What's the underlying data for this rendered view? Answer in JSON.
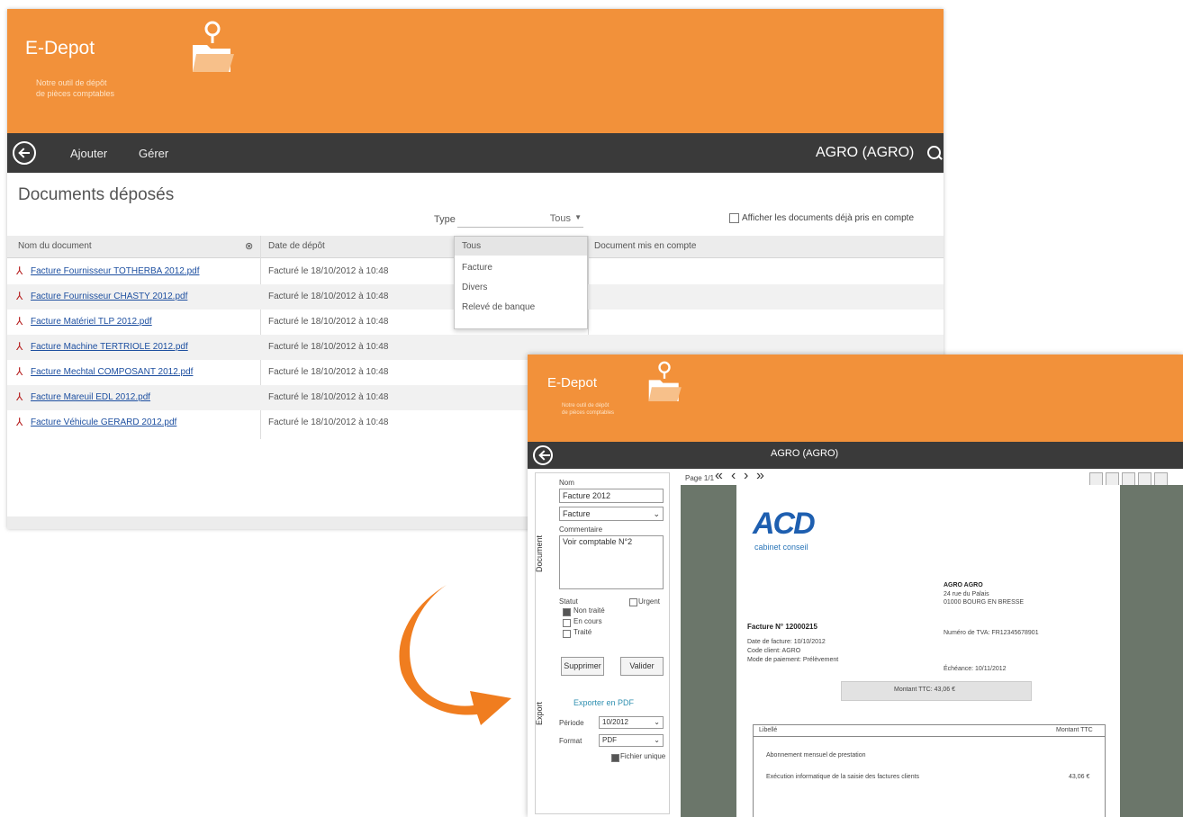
{
  "colors": {
    "accent": "#f2913a",
    "navbar": "#3a3a3a",
    "arrow": "#f07d1f",
    "viewer_bg": "#6b766a",
    "link": "#1d4fa0"
  },
  "main_window": {
    "app_title": "E-Depot",
    "app_subtitle": [
      "Notre outil de dépôt",
      "de pièces comptables"
    ],
    "nav": {
      "add": "Ajouter",
      "manage": "Gérer",
      "org": "AGRO (AGRO)"
    },
    "page_title": "Documents déposés",
    "type_filter": {
      "label": "Type",
      "value": "Tous"
    },
    "show_accounted_label": "Afficher les documents déjà pris en compte",
    "columns": [
      "Nom du document",
      "Date de dépôt",
      "Document mis en compte"
    ],
    "type_options": [
      "Tous",
      "Facture",
      "Divers",
      "Relevé de banque"
    ],
    "documents": [
      {
        "name": "Facture Fournisseur TOTHERBA 2012.pdf",
        "date": "Facturé le 18/10/2012 à 10:48"
      },
      {
        "name": "Facture Fournisseur CHASTY 2012.pdf",
        "date": "Facturé le 18/10/2012 à 10:48"
      },
      {
        "name": "Facture Matériel TLP 2012.pdf",
        "date": "Facturé le 18/10/2012 à 10:48"
      },
      {
        "name": "Facture Machine TERTRIOLE 2012.pdf",
        "date": "Facturé le 18/10/2012 à 10:48"
      },
      {
        "name": "Facture Mechtal COMPOSANT 2012.pdf",
        "date": "Facturé le 18/10/2012 à 10:48"
      },
      {
        "name": "Facture Mareuil EDL 2012.pdf",
        "date": "Facturé le 18/10/2012 à 10:48"
      },
      {
        "name": "Facture Véhicule GERARD 2012.pdf",
        "date": "Facturé le 18/10/2012 à 10:48"
      }
    ]
  },
  "detail_window": {
    "app_title": "E-Depot",
    "app_subtitle": [
      "Notre outil de dépôt",
      "de pièces comptables"
    ],
    "org": "AGRO (AGRO)",
    "side_tab_doc": "Document",
    "side_tab_export": "Export",
    "form": {
      "name_label": "Nom",
      "name_value": "Facture 2012",
      "type_value": "Facture",
      "comment_label": "Commentaire",
      "comment_value": "Voir comptable N°2",
      "status_label": "Statut",
      "status_options": [
        "Non traité",
        "En cours",
        "Traité"
      ],
      "urgent_label": "Urgent",
      "delete_button": "Supprimer",
      "save_button": "Valider",
      "export_title": "Exporter en PDF",
      "period_label": "Période",
      "period_value": "10/2012",
      "format_label": "Format",
      "format_value": "PDF",
      "export_option": "Fichier unique"
    },
    "viewer": {
      "page_label": "Page 1/1",
      "logo_main": "ACD",
      "logo_sub": "cabinet conseil",
      "invoice_title": "Facture N° 12000215",
      "meta": [
        "Date de facture: 10/10/2012",
        "Code client: AGRO",
        "Mode de paiement: Prélèvement"
      ],
      "client": [
        "AGRO AGRO",
        "24 rue du Palais",
        "01000 BOURG EN BRESSE"
      ],
      "client_extra": "Numéro de TVA: FR12345678901",
      "due": "Échéance: 10/11/2012",
      "amount_banner": "Montant TTC: 43,06 €",
      "table_header": [
        "Libellé",
        "Montant TTC"
      ],
      "lines": [
        {
          "label": "Abonnement mensuel de prestation",
          "amount": ""
        },
        {
          "label": "Exécution informatique de la saisie des factures clients",
          "amount": "43,06 €"
        }
      ]
    }
  }
}
